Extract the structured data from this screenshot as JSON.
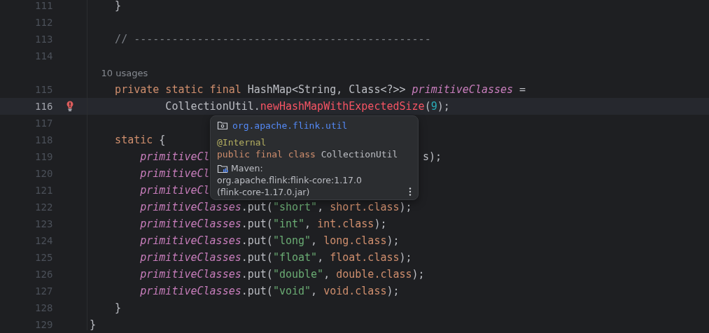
{
  "editor": {
    "lines": [
      {
        "number": "111",
        "current": false,
        "code": [
          {
            "text": "    }",
            "kind": "plain"
          }
        ]
      },
      {
        "number": "112",
        "current": false
      },
      {
        "number": "113",
        "current": false,
        "code": [
          {
            "text": "    // -----------------------------------------------",
            "kind": "comment"
          }
        ]
      },
      {
        "number": "114",
        "current": false
      },
      {
        "kind": "inlay",
        "text": "10 usages"
      },
      {
        "number": "115",
        "current": false,
        "code": [
          {
            "text": "    private static final ",
            "kind": "kw"
          },
          {
            "text": "HashMap<String, Class<?>> ",
            "kind": "plain"
          },
          {
            "text": "primitiveClasses",
            "kind": "field"
          },
          {
            "text": " =",
            "kind": "plain"
          }
        ]
      },
      {
        "number": "116",
        "current": true,
        "gutter_icon": {
          "kind": "error_bulb"
        },
        "code": [
          {
            "text": "            CollectionUtil",
            "kind": "plain"
          },
          {
            "text": ".",
            "kind": "plain"
          },
          {
            "text": "newHashMapWithExpectedSize",
            "kind": "error"
          },
          {
            "text": "(",
            "kind": "plain"
          },
          {
            "text": "9",
            "kind": "num"
          },
          {
            "text": ");",
            "kind": "plain"
          }
        ]
      },
      {
        "number": "117",
        "current": false
      },
      {
        "number": "118",
        "current": false,
        "code": [
          {
            "text": "    static",
            "kind": "kw"
          },
          {
            "text": " {",
            "kind": "plain"
          }
        ]
      },
      {
        "number": "119",
        "current": false,
        "code": [
          {
            "text": "        primitiveCl",
            "kind": "field"
          }
        ],
        "after_popup": [
          {
            "text": "s);",
            "kind": "plain"
          }
        ]
      },
      {
        "number": "120",
        "current": false,
        "code": [
          {
            "text": "        primitiveCl",
            "kind": "field"
          }
        ]
      },
      {
        "number": "121",
        "current": false,
        "code": [
          {
            "text": "        primitiveCl",
            "kind": "field"
          }
        ]
      },
      {
        "number": "122",
        "current": false,
        "code": [
          {
            "text": "        primitiveClasses",
            "kind": "field"
          },
          {
            "text": ".put(",
            "kind": "plain"
          },
          {
            "text": "\"short\"",
            "kind": "str"
          },
          {
            "text": ", ",
            "kind": "plain"
          },
          {
            "text": "short.class",
            "kind": "kw"
          },
          {
            "text": ");",
            "kind": "plain"
          }
        ]
      },
      {
        "number": "123",
        "current": false,
        "code": [
          {
            "text": "        primitiveClasses",
            "kind": "field"
          },
          {
            "text": ".put(",
            "kind": "plain"
          },
          {
            "text": "\"int\"",
            "kind": "str"
          },
          {
            "text": ", ",
            "kind": "plain"
          },
          {
            "text": "int.class",
            "kind": "kw"
          },
          {
            "text": ");",
            "kind": "plain"
          }
        ]
      },
      {
        "number": "124",
        "current": false,
        "code": [
          {
            "text": "        primitiveClasses",
            "kind": "field"
          },
          {
            "text": ".put(",
            "kind": "plain"
          },
          {
            "text": "\"long\"",
            "kind": "str"
          },
          {
            "text": ", ",
            "kind": "plain"
          },
          {
            "text": "long.class",
            "kind": "kw"
          },
          {
            "text": ");",
            "kind": "plain"
          }
        ]
      },
      {
        "number": "125",
        "current": false,
        "code": [
          {
            "text": "        primitiveClasses",
            "kind": "field"
          },
          {
            "text": ".put(",
            "kind": "plain"
          },
          {
            "text": "\"float\"",
            "kind": "str"
          },
          {
            "text": ", ",
            "kind": "plain"
          },
          {
            "text": "float.class",
            "kind": "kw"
          },
          {
            "text": ");",
            "kind": "plain"
          }
        ]
      },
      {
        "number": "126",
        "current": false,
        "code": [
          {
            "text": "        primitiveClasses",
            "kind": "field"
          },
          {
            "text": ".put(",
            "kind": "plain"
          },
          {
            "text": "\"double\"",
            "kind": "str"
          },
          {
            "text": ", ",
            "kind": "plain"
          },
          {
            "text": "double.class",
            "kind": "kw"
          },
          {
            "text": ");",
            "kind": "plain"
          }
        ]
      },
      {
        "number": "127",
        "current": false,
        "code": [
          {
            "text": "        primitiveClasses",
            "kind": "field"
          },
          {
            "text": ".put(",
            "kind": "plain"
          },
          {
            "text": "\"void\"",
            "kind": "str"
          },
          {
            "text": ", ",
            "kind": "plain"
          },
          {
            "text": "void.class",
            "kind": "kw"
          },
          {
            "text": ");",
            "kind": "plain"
          }
        ]
      },
      {
        "number": "128",
        "current": false,
        "code": [
          {
            "text": "    }",
            "kind": "plain"
          }
        ]
      },
      {
        "number": "129",
        "current": false,
        "code": [
          {
            "text": "}",
            "kind": "plain"
          }
        ]
      }
    ]
  },
  "popup": {
    "package": "org.apache.flink.util",
    "annotation": "@Internal",
    "declaration": [
      {
        "text": "public final class ",
        "kind": "kw"
      },
      {
        "text": "CollectionUtil",
        "kind": "plain"
      }
    ],
    "library_label": "Maven:",
    "library_lines": [
      "org.apache.flink:flink-core:1.17.0",
      "(flink-core-1.17.0.jar)"
    ]
  }
}
